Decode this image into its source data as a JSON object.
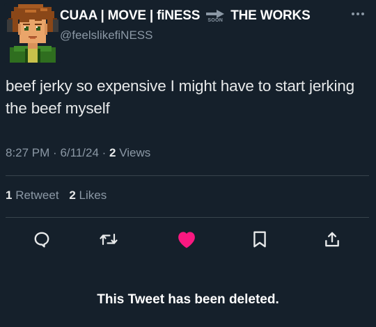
{
  "author": {
    "name_parts": [
      "CUAA | MOVE | fiNESS",
      "THE WORKS"
    ],
    "arrow_label": "SOON",
    "handle": "@feelslikefiNESS"
  },
  "more_icon": "more-horizontal-icon",
  "tweet": {
    "text": "beef jerky so expensive I might have to start jerking the beef myself"
  },
  "meta": {
    "time": "8:27 PM",
    "date": "6/11/24",
    "views_count": "2",
    "views_label": "Views"
  },
  "stats": {
    "retweets_count": "1",
    "retweets_label": "Retweet",
    "likes_count": "2",
    "likes_label": "Likes"
  },
  "actions": {
    "reply_icon": "reply-icon",
    "retweet_icon": "retweet-icon",
    "like_icon": "heart-icon",
    "bookmark_icon": "bookmark-icon",
    "share_icon": "share-icon"
  },
  "notice": "This Tweet has been deleted.",
  "colors": {
    "background": "#15202b",
    "text": "#e7e9ea",
    "secondary": "#8b98a5",
    "divider": "#38444d",
    "like": "#f91880"
  }
}
